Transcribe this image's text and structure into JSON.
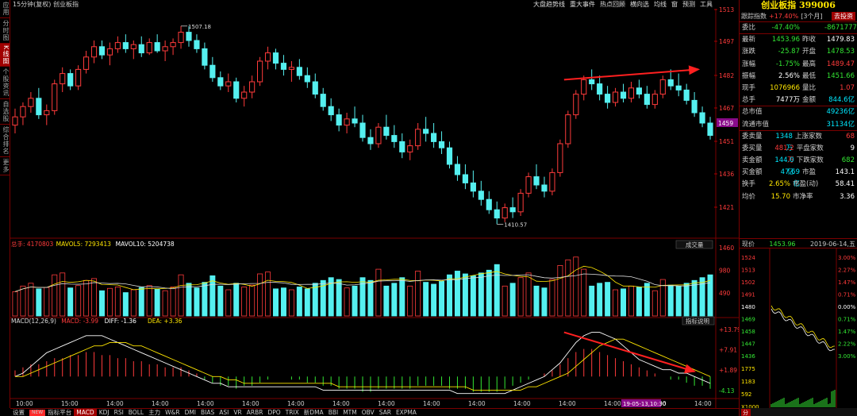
{
  "left_tabs": [
    "应用",
    "分时图",
    "K线图",
    "个股资讯",
    "自选股",
    "综合排名",
    "更多"
  ],
  "left_tab_active": 2,
  "chart_title": "15分钟(复权) 创业板指",
  "top_menu": [
    "大盘趋势线",
    "重大事件",
    "热点回顾",
    "横向选",
    "均线",
    "窗",
    "预测",
    "工具"
  ],
  "price_axis": [
    "1513",
    "1497",
    "1482",
    "1467",
    "1451",
    "1436",
    "1421"
  ],
  "price_current_tag": "1459",
  "price_high_label": "1507.18",
  "price_low_label": "1410.57",
  "volume_legend": {
    "label": "总手: 4170803",
    "mavol5": "MAVOL5: 7293413",
    "mavol10": "MAVOL10: 5204738",
    "button": "成交量"
  },
  "volume_axis": [
    "1460",
    "980",
    "490"
  ],
  "macd_legend": {
    "label": "MACD(12,26,9)",
    "macd": "MACD: -3.99",
    "diff": "DIFF: -1.36",
    "dea": "DEA: +3.36",
    "button": "指标说明"
  },
  "macd_axis": [
    "+13.79",
    "+7.91",
    "+1.89",
    "-4.13"
  ],
  "time_axis": [
    "10:00",
    "15:00",
    "14:00",
    "14:00",
    "14:00",
    "14:00",
    "14:00",
    "14:00",
    "14:00",
    "14:00",
    "14:00",
    "14:00",
    "14:00",
    "14:00",
    "14:00",
    "14:00"
  ],
  "time_highlight": "19-05-13,10:30",
  "bottom_tabs": [
    "设置",
    "NEW",
    "指标平台",
    "MACD",
    "KDJ",
    "RSI",
    "BOLL",
    "主力",
    "W&R",
    "DMI",
    "BIAS",
    "ASI",
    "VR",
    "ARBR",
    "DPO",
    "TRIX",
    "新DMA",
    "BBI",
    "MTM",
    "OBV",
    "SAR",
    "EXPMA"
  ],
  "bottom_tab_active": "MACD",
  "right_panel": {
    "title": "创业板指 399006",
    "sub_label": "跟踪指数",
    "sub_change": "+17.40%",
    "sub_period": "[3个月]",
    "sub_button": "去投资",
    "rows": [
      {
        "k": "委比",
        "v": "-47.40%",
        "k2": "",
        "v2": "-8671777",
        "c1": "grn",
        "c2": "grn"
      },
      {
        "k": "最新",
        "v": "1453.96",
        "k2": "昨收",
        "v2": "1479.83",
        "c1": "grn",
        "c2": "wht"
      },
      {
        "k": "涨跌",
        "v": "-25.87",
        "k2": "开盘",
        "v2": "1478.53",
        "c1": "grn",
        "c2": "grn"
      },
      {
        "k": "涨幅",
        "v": "-1.75%",
        "k2": "最高",
        "v2": "1489.47",
        "c1": "grn",
        "c2": "red"
      },
      {
        "k": "振幅",
        "v": "2.56%",
        "k2": "最低",
        "v2": "1451.66",
        "c1": "wht",
        "c2": "grn"
      },
      {
        "k": "现手",
        "v": "1076966",
        "k2": "量比",
        "v2": "1.07",
        "c1": "yel",
        "c2": "red"
      },
      {
        "k": "总手",
        "v": "7477万",
        "k2": "金额",
        "v2": "844.6亿",
        "c1": "wht",
        "c2": "cyn"
      },
      {
        "k": "总市值",
        "v": "",
        "k2": "",
        "v2": "49236亿",
        "c1": "wht",
        "c2": "cyn"
      },
      {
        "k": "流通市值",
        "v": "",
        "k2": "",
        "v2": "31134亿",
        "c1": "wht",
        "c2": "cyn"
      },
      {
        "k": "委卖量",
        "v": "1348万",
        "k2": "上涨家数",
        "v2": "68",
        "c1": "cyn",
        "c2": "red"
      },
      {
        "k": "委买量",
        "v": "481.2万",
        "k2": "平盘家数",
        "v2": "9",
        "c1": "red",
        "c2": "wht"
      },
      {
        "k": "卖金额",
        "v": "144.0亿",
        "k2": "下跌家数",
        "v2": "682",
        "c1": "cyn",
        "c2": "grn"
      },
      {
        "k": "买金额",
        "v": "47.69亿",
        "k2": "市盈",
        "v2": "143.1",
        "c1": "cyn",
        "c2": "wht"
      },
      {
        "k": "换手",
        "v": "2.65%",
        "k2": "市盈(动)",
        "v2": "58.41",
        "c1": "yel",
        "c2": "wht"
      },
      {
        "k": "均价",
        "v": "15.70",
        "k2": "市净率",
        "v2": "3.36",
        "c1": "yel",
        "c2": "wht"
      }
    ],
    "mini_head_left": "现价",
    "mini_price": "1453.96",
    "mini_date": "2019-06-14,五",
    "mini_left_axis": [
      "1524",
      "1513",
      "1502",
      "1491",
      "1480",
      "1469",
      "1458",
      "1447",
      "1436",
      "1775",
      "1183",
      "592",
      "X1000"
    ],
    "mini_right_axis": [
      "3.00%",
      "2.27%",
      "1.47%",
      "0.71%",
      "0.00%",
      "0.71%",
      "1.47%",
      "2.22%",
      "3.00%"
    ],
    "mini_time_tab": "分"
  },
  "chart_data": {
    "type": "candlestick",
    "price_range": [
      1405,
      1515
    ],
    "ohlc": [
      [
        1459,
        1467,
        1455,
        1463
      ],
      [
        1463,
        1470,
        1459,
        1468
      ],
      [
        1468,
        1475,
        1465,
        1472
      ],
      [
        1472,
        1477,
        1462,
        1464
      ],
      [
        1464,
        1469,
        1459,
        1466
      ],
      [
        1466,
        1481,
        1464,
        1479
      ],
      [
        1479,
        1487,
        1475,
        1484
      ],
      [
        1484,
        1486,
        1476,
        1478
      ],
      [
        1478,
        1488,
        1476,
        1486
      ],
      [
        1486,
        1495,
        1484,
        1492
      ],
      [
        1492,
        1500,
        1489,
        1497
      ],
      [
        1497,
        1500,
        1491,
        1493
      ],
      [
        1493,
        1499,
        1488,
        1496
      ],
      [
        1496,
        1502,
        1494,
        1499
      ],
      [
        1499,
        1503,
        1494,
        1496
      ],
      [
        1496,
        1500,
        1491,
        1498
      ],
      [
        1498,
        1502,
        1492,
        1494
      ],
      [
        1494,
        1501,
        1493,
        1499
      ],
      [
        1499,
        1503,
        1494,
        1495
      ],
      [
        1495,
        1500,
        1490,
        1497
      ],
      [
        1497,
        1501,
        1493,
        1499
      ],
      [
        1499,
        1507,
        1496,
        1504
      ],
      [
        1504,
        1507,
        1497,
        1500
      ],
      [
        1500,
        1503,
        1494,
        1496
      ],
      [
        1496,
        1499,
        1486,
        1488
      ],
      [
        1488,
        1492,
        1480,
        1482
      ],
      [
        1482,
        1485,
        1476,
        1478
      ],
      [
        1478,
        1484,
        1475,
        1480
      ],
      [
        1480,
        1482,
        1470,
        1472
      ],
      [
        1472,
        1478,
        1468,
        1475
      ],
      [
        1475,
        1483,
        1472,
        1480
      ],
      [
        1480,
        1492,
        1478,
        1490
      ],
      [
        1490,
        1497,
        1486,
        1494
      ],
      [
        1494,
        1496,
        1486,
        1489
      ],
      [
        1489,
        1493,
        1483,
        1486
      ],
      [
        1486,
        1490,
        1480,
        1487
      ],
      [
        1487,
        1491,
        1481,
        1483
      ],
      [
        1483,
        1487,
        1477,
        1480
      ],
      [
        1480,
        1484,
        1472,
        1474
      ],
      [
        1474,
        1477,
        1466,
        1468
      ],
      [
        1468,
        1472,
        1461,
        1464
      ],
      [
        1464,
        1467,
        1456,
        1459
      ],
      [
        1459,
        1465,
        1455,
        1462
      ],
      [
        1462,
        1468,
        1458,
        1460
      ],
      [
        1460,
        1464,
        1451,
        1453
      ],
      [
        1453,
        1457,
        1447,
        1450
      ],
      [
        1450,
        1460,
        1448,
        1458
      ],
      [
        1458,
        1464,
        1452,
        1454
      ],
      [
        1454,
        1459,
        1448,
        1451
      ],
      [
        1451,
        1455,
        1443,
        1446
      ],
      [
        1446,
        1452,
        1442,
        1449
      ],
      [
        1449,
        1460,
        1447,
        1457
      ],
      [
        1457,
        1463,
        1451,
        1455
      ],
      [
        1455,
        1460,
        1448,
        1451
      ],
      [
        1451,
        1456,
        1445,
        1448
      ],
      [
        1448,
        1451,
        1438,
        1440
      ],
      [
        1440,
        1444,
        1432,
        1435
      ],
      [
        1435,
        1440,
        1428,
        1431
      ],
      [
        1431,
        1437,
        1424,
        1427
      ],
      [
        1427,
        1432,
        1420,
        1423
      ],
      [
        1423,
        1427,
        1416,
        1418
      ],
      [
        1418,
        1422,
        1411,
        1414
      ],
      [
        1414,
        1421,
        1412,
        1419
      ],
      [
        1419,
        1424,
        1414,
        1417
      ],
      [
        1417,
        1428,
        1415,
        1426
      ],
      [
        1426,
        1436,
        1424,
        1434
      ],
      [
        1434,
        1440,
        1428,
        1430
      ],
      [
        1430,
        1434,
        1424,
        1427
      ],
      [
        1427,
        1438,
        1425,
        1436
      ],
      [
        1436,
        1452,
        1434,
        1450
      ],
      [
        1450,
        1466,
        1448,
        1464
      ],
      [
        1464,
        1476,
        1462,
        1474
      ],
      [
        1474,
        1483,
        1471,
        1481
      ],
      [
        1481,
        1486,
        1476,
        1479
      ],
      [
        1479,
        1483,
        1471,
        1474
      ],
      [
        1474,
        1478,
        1467,
        1470
      ],
      [
        1470,
        1477,
        1468,
        1475
      ],
      [
        1475,
        1479,
        1470,
        1472
      ],
      [
        1472,
        1480,
        1470,
        1477
      ],
      [
        1477,
        1481,
        1472,
        1474
      ],
      [
        1474,
        1478,
        1467,
        1469
      ],
      [
        1469,
        1476,
        1467,
        1474
      ],
      [
        1474,
        1483,
        1472,
        1481
      ],
      [
        1481,
        1486,
        1476,
        1478
      ],
      [
        1478,
        1484,
        1473,
        1476
      ],
      [
        1476,
        1479,
        1469,
        1471
      ],
      [
        1471,
        1475,
        1463,
        1465
      ],
      [
        1465,
        1468,
        1458,
        1460
      ],
      [
        1460,
        1463,
        1452,
        1454
      ]
    ],
    "volume": [
      520,
      640,
      700,
      580,
      610,
      880,
      920,
      600,
      650,
      760,
      800,
      540,
      590,
      620,
      500,
      560,
      610,
      650,
      580,
      540,
      620,
      880,
      700,
      600,
      720,
      860,
      640,
      560,
      700,
      620,
      660,
      900,
      940,
      580,
      600,
      560,
      620,
      580,
      700,
      760,
      820,
      780,
      600,
      640,
      820,
      760,
      1000,
      640,
      700,
      820,
      640,
      960,
      720,
      680,
      740,
      880,
      960,
      900,
      860,
      920,
      980,
      1100,
      640,
      700,
      820,
      920,
      640,
      600,
      780,
      1080,
      1200,
      1260,
      1000,
      640,
      700,
      720,
      560,
      580,
      640,
      620,
      700,
      540,
      780,
      660,
      640,
      700,
      760,
      820,
      880
    ],
    "macd_range": [
      -6,
      15
    ],
    "macd_hist": [
      2,
      3,
      4,
      4,
      5,
      6,
      6,
      7,
      7,
      8,
      8,
      7,
      7,
      6,
      6,
      5,
      5,
      4,
      4,
      3,
      3,
      3,
      2,
      1,
      -1,
      -2,
      -3,
      -3,
      -4,
      -3,
      -3,
      -2,
      -1,
      0,
      0,
      -1,
      -1,
      -2,
      -2,
      -3,
      -3,
      -4,
      -4,
      -4,
      -5,
      -5,
      -4,
      -4,
      -4,
      -4,
      -4,
      -3,
      -3,
      -3,
      -3,
      -4,
      -4,
      -4,
      -5,
      -5,
      -5,
      -5,
      -4,
      -3,
      -2,
      -1,
      0,
      1,
      2,
      4,
      6,
      8,
      9,
      9,
      8,
      7,
      6,
      5,
      4,
      3,
      2,
      1,
      0,
      -1,
      -1,
      -2,
      -3,
      -3,
      -4
    ],
    "macd_diff": [
      0,
      1,
      3,
      5,
      7,
      8,
      9,
      10,
      11,
      12,
      12,
      12,
      11,
      10,
      9,
      8,
      7,
      6,
      5,
      4,
      3,
      2,
      1,
      0,
      -1,
      -2,
      -2,
      -3,
      -3,
      -3,
      -3,
      -3,
      -3,
      -3,
      -3,
      -3,
      -3,
      -3,
      -3,
      -4,
      -4,
      -4,
      -4,
      -4,
      -4,
      -4,
      -4,
      -4,
      -4,
      -4,
      -4,
      -4,
      -4,
      -4,
      -4,
      -4,
      -5,
      -5,
      -5,
      -5,
      -5,
      -5,
      -5,
      -4,
      -3,
      -2,
      -1,
      0,
      2,
      4,
      7,
      10,
      12,
      13,
      13,
      12,
      11,
      9,
      7,
      5,
      4,
      3,
      2,
      2,
      1,
      1,
      0,
      -1,
      -2
    ],
    "macd_dea": [
      0,
      0,
      1,
      2,
      3,
      4,
      5,
      6,
      7,
      8,
      9,
      9,
      10,
      10,
      10,
      9,
      9,
      8,
      7,
      6,
      5,
      4,
      3,
      2,
      1,
      0,
      0,
      -1,
      -1,
      -2,
      -2,
      -2,
      -2,
      -2,
      -2,
      -2,
      -2,
      -2,
      -2,
      -2,
      -2,
      -3,
      -3,
      -3,
      -3,
      -3,
      -3,
      -3,
      -3,
      -3,
      -3,
      -3,
      -3,
      -3,
      -3,
      -3,
      -3,
      -3,
      -4,
      -4,
      -4,
      -4,
      -4,
      -4,
      -4,
      -3,
      -3,
      -2,
      -1,
      0,
      1,
      3,
      5,
      7,
      9,
      10,
      11,
      11,
      10,
      9,
      8,
      7,
      6,
      5,
      4,
      3,
      2,
      1,
      0
    ]
  }
}
